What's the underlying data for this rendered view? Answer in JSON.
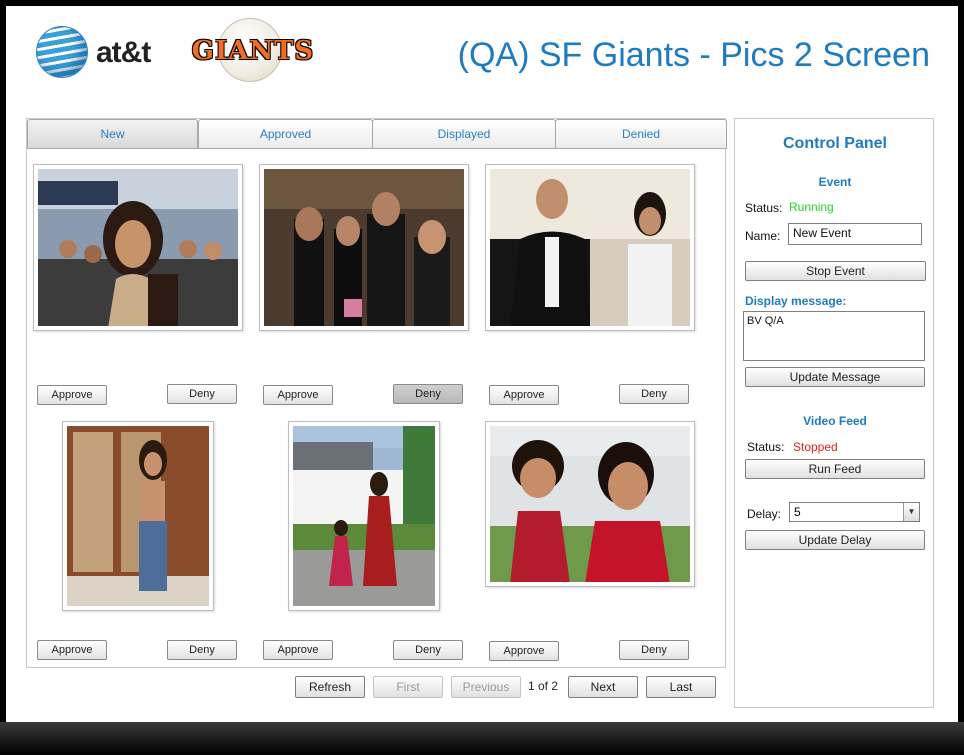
{
  "header": {
    "att_logo_text": "at&t",
    "giants_logo_text": "GIANTS",
    "title": "(QA) SF Giants - Pics 2 Screen"
  },
  "tabs": [
    {
      "label": "New",
      "active": true
    },
    {
      "label": "Approved",
      "active": false
    },
    {
      "label": "Displayed",
      "active": false
    },
    {
      "label": "Denied",
      "active": false
    }
  ],
  "photos": [
    {
      "approve_label": "Approve",
      "deny_label": "Deny",
      "deny_pressed": false
    },
    {
      "approve_label": "Approve",
      "deny_label": "Deny",
      "deny_pressed": true
    },
    {
      "approve_label": "Approve",
      "deny_label": "Deny",
      "deny_pressed": false
    },
    {
      "approve_label": "Approve",
      "deny_label": "Deny",
      "deny_pressed": false
    },
    {
      "approve_label": "Approve",
      "deny_label": "Deny",
      "deny_pressed": false
    },
    {
      "approve_label": "Approve",
      "deny_label": "Deny",
      "deny_pressed": false
    }
  ],
  "pagination": {
    "refresh": "Refresh",
    "first": "First",
    "previous": "Previous",
    "indicator": "1 of 2",
    "next": "Next",
    "last": "Last"
  },
  "control_panel": {
    "title": "Control Panel",
    "event_section": "Event",
    "status_label": "Status:",
    "status_value": "Running",
    "status_color": "#2ecc2e",
    "name_label": "Name:",
    "name_value": "New Event",
    "stop_event": "Stop Event",
    "display_message_label": "Display message:",
    "display_message_value": "BV Q/A",
    "update_message": "Update Message",
    "video_section": "Video Feed",
    "video_status_label": "Status:",
    "video_status_value": "Stopped",
    "video_status_color": "#e01f1f",
    "run_feed": "Run Feed",
    "delay_label": "Delay:",
    "delay_value": "5",
    "update_delay": "Update Delay"
  },
  "colors": {
    "accent": "#1e7bbf"
  }
}
